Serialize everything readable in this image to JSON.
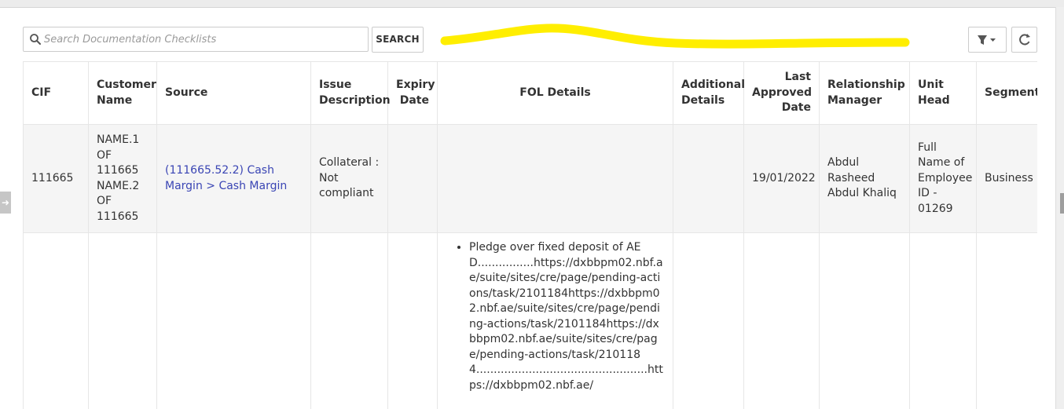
{
  "search": {
    "placeholder": "Search Documentation Checklists",
    "button_label": "SEARCH"
  },
  "toolbar": {
    "filter_icon": "filter-icon",
    "refresh_icon": "refresh-icon"
  },
  "colors": {
    "highlight": "#ffee00",
    "link": "#3a45b4",
    "row_alt_bg": "#f5f5f5"
  },
  "table": {
    "columns": [
      "CIF",
      "Customer Name",
      "Source",
      "Issue Description",
      "Expiry Date",
      "FOL Details",
      "Additional Details",
      "Last Approved Date",
      "Relationship Manager",
      "Unit Head",
      "Segment"
    ],
    "rows": [
      {
        "cif": "111665",
        "customer_name": "NAME.1 OF 111665 NAME.2 OF 111665",
        "source": "(111665.52.2) Cash Margin > Cash Margin",
        "issue_description": "Collateral : Not compliant",
        "expiry_date": "",
        "fol_details": "",
        "additional_details": "",
        "last_approved_date": "19/01/2022",
        "relationship_manager": "Abdul Rasheed Abdul Khaliq",
        "unit_head": "Full Name of Employee ID - 01269",
        "segment": "Business Banking - NE"
      },
      {
        "cif": "",
        "customer_name": "",
        "source": "",
        "issue_description": "",
        "expiry_date": "",
        "fol_details": "Pledge over fixed deposit of AED................https://dxbbpm02.nbf.ae/suite/sites/cre/page/pending-actions/task/2101184https://dxbbpm02.nbf.ae/suite/sites/cre/page/pending-actions/task/2101184https://dxbbpm02.nbf.ae/suite/sites/cre/page/pending-actions/task/2101184.................................................https://dxbbpm02.nbf.ae/",
        "additional_details": "",
        "last_approved_date": "",
        "relationship_manager": "",
        "unit_head": "",
        "segment": ""
      }
    ]
  }
}
